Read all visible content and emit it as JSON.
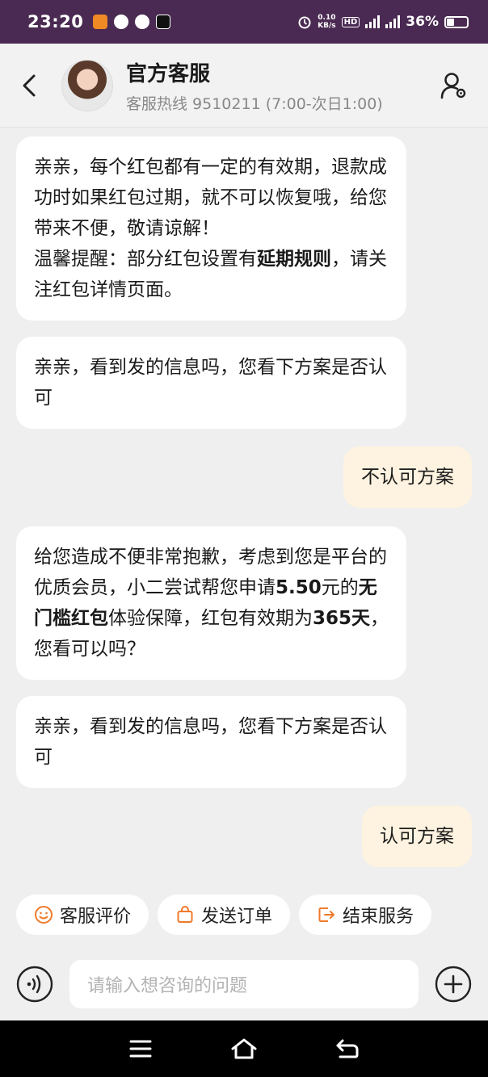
{
  "status_bar": {
    "time": "23:20",
    "speed_value": "0.10",
    "speed_unit": "KB/s",
    "hd_label": "HD",
    "battery_percent": "36%",
    "battery_level": 0.36
  },
  "header": {
    "title": "官方客服",
    "subtitle": "客服热线 9510211 (7:00-次日1:00)"
  },
  "messages": [
    {
      "side": "left",
      "parts": [
        {
          "text": "亲亲，每个红包都有一定的有效期，退款成功时如果红包过期，就不可以恢复哦，给您带来不便，敬请谅解！",
          "bold": false
        },
        {
          "text": "温馨提醒：部分红包设置有",
          "bold": false
        },
        {
          "text": "延期规则",
          "bold": true
        },
        {
          "text": "，请关注红包详情页面。",
          "bold": false
        }
      ]
    },
    {
      "side": "left",
      "text": "亲亲，看到发的信息吗，您看下方案是否认可"
    },
    {
      "side": "right",
      "text": "不认可方案"
    },
    {
      "side": "left",
      "parts": [
        {
          "text": "给您造成不便非常抱歉，考虑到您是平台的优质会员，小二尝试帮您申请",
          "bold": false
        },
        {
          "text": "5.50",
          "bold": true
        },
        {
          "text": "元的",
          "bold": false
        },
        {
          "text": "无门槛红包",
          "bold": true
        },
        {
          "text": "体验保障，红包有效期为",
          "bold": false
        },
        {
          "text": "365天",
          "bold": true
        },
        {
          "text": "，您看可以吗？",
          "bold": false
        }
      ]
    },
    {
      "side": "left",
      "text": "亲亲，看到发的信息吗，您看下方案是否认可"
    },
    {
      "side": "right",
      "text": "认可方案"
    }
  ],
  "quick_actions": {
    "rate": "客服评价",
    "order": "发送订单",
    "end": "结束服务"
  },
  "input": {
    "placeholder": "请输入想咨询的问题"
  },
  "colors": {
    "status_bg": "#4a2a52",
    "accent_orange": "#f07a2a",
    "right_bubble": "#fdf3e0"
  }
}
